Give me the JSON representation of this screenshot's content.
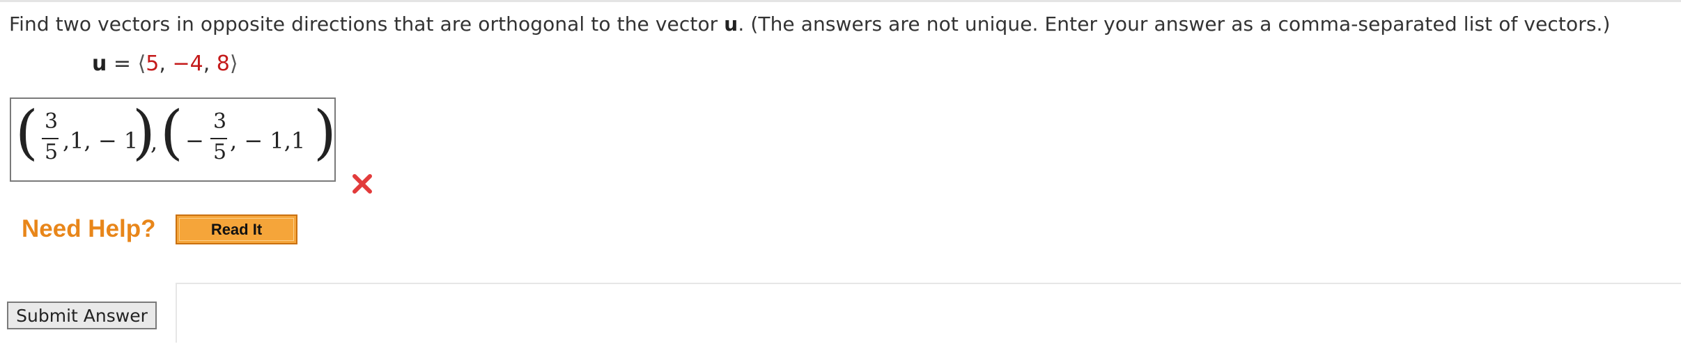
{
  "question": {
    "text_before": "Find two vectors in opposite directions that are orthogonal to the vector ",
    "vector_name": "u",
    "text_after": ". (The answers are not unique. Enter your answer as a comma-separated list of vectors.)"
  },
  "vector": {
    "name": "u",
    "equals": " = ",
    "open": "⟨",
    "close": "⟩",
    "sep": ", ",
    "components": [
      "5",
      "−4",
      "8"
    ]
  },
  "answer": {
    "v1": {
      "num": "3",
      "den": "5",
      "rest": ",1, − 1"
    },
    "comma": ",",
    "v2": {
      "sign": "−",
      "num": "3",
      "den": "5",
      "rest": ", − 1,1"
    },
    "status": "incorrect"
  },
  "help": {
    "label": "Need Help?",
    "button": "Read It"
  },
  "submit": {
    "label": "Submit Answer"
  },
  "colors": {
    "incorrect": "#e23b3b",
    "help_orange": "#e8861a",
    "button_orange": "#f5a53a",
    "value_red": "#c41a1a"
  }
}
